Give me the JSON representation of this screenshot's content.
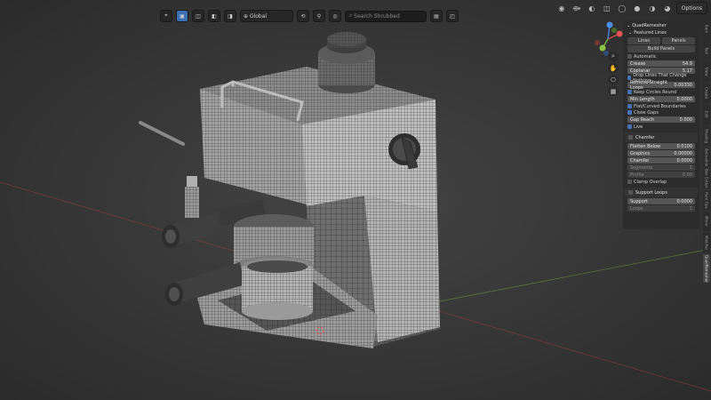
{
  "header": {
    "transform_orientation": "Global",
    "search_placeholder": "Search Shrubbed"
  },
  "options_label": "Options",
  "panel": {
    "title": "QuadRemesher",
    "featured_lines_label": "Featured Lines",
    "lines_label": "Lines",
    "panels_label": "Panels",
    "build_panels_label": "Build Panels",
    "automatic_label": "Automatic",
    "crease_label": "Crease",
    "crease_value": "54.9",
    "coplanar_label": "Coplanar",
    "coplanar_value": "5.17",
    "drop_lines_label": "Drop Lines That Change Nothing",
    "remove_straight_label": "Remove Straight Loops",
    "remove_straight_value": "0.00330",
    "keep_circles_label": "Keep Circles Round",
    "min_length_label": "Min Length",
    "min_length_value": "0.0000",
    "flat_curved_label": "Flat/Curved Boundaries",
    "close_gaps_label": "Close Gaps",
    "gap_reach_label": "Gap Reach",
    "gap_reach_value": "0.000",
    "live_label": "Live",
    "chamfer_label": "Chamfer",
    "flatten_below_label": "Flatten Below",
    "flatten_below_value": "0.0100",
    "graphics_label": "Graphics",
    "graphics_value": "0.00000",
    "chamfer_field_label": "Chamfer",
    "chamfer_field_value": "0.0000",
    "segments_label": "Segments",
    "segments_value": "1",
    "profile_label": "Profile",
    "profile_value": "0.50",
    "clamp_overlap_label": "Clamp Overlap",
    "support_loops_label": "Support Loops",
    "support_label": "Support",
    "support_value": "0.0000",
    "loops_label": "Loops",
    "loops_value": "1"
  },
  "vtabs": [
    "Item",
    "Tool",
    "View",
    "Create",
    "Edit",
    "Shading",
    "Animation",
    "Box Cutter",
    "Hard Ops",
    "Mirror",
    "Modifier",
    "QuadRemesher"
  ]
}
